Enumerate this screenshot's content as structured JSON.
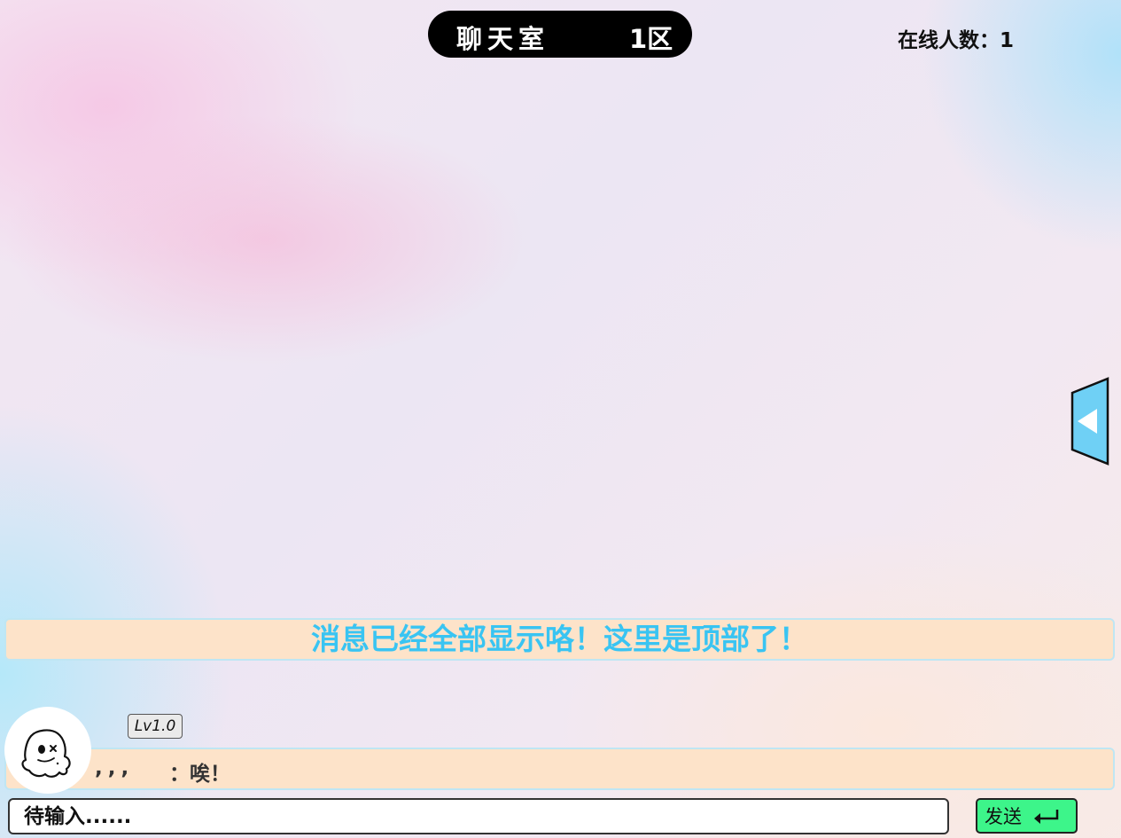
{
  "header": {
    "title": "聊天室",
    "zone": "1区",
    "online_count": "在线人数：1"
  },
  "notice": {
    "top_message": "消息已经全部显示咯！这里是顶部了！"
  },
  "messages": [
    {
      "level": "Lv1.0",
      "sender": ",,,",
      "text": "：唉！",
      "avatar_icon": "ghost-icon"
    }
  ],
  "composer": {
    "placeholder": "待输入......",
    "send_label": "发送",
    "send_icon": "enter-icon"
  },
  "side_toggle": {
    "icon": "triangle-left-icon"
  },
  "colors": {
    "notice_bg": "#fde3c9",
    "notice_text": "#39c4f2",
    "send_button": "#3df58a",
    "toggle_fill": "#6fd0f5"
  }
}
